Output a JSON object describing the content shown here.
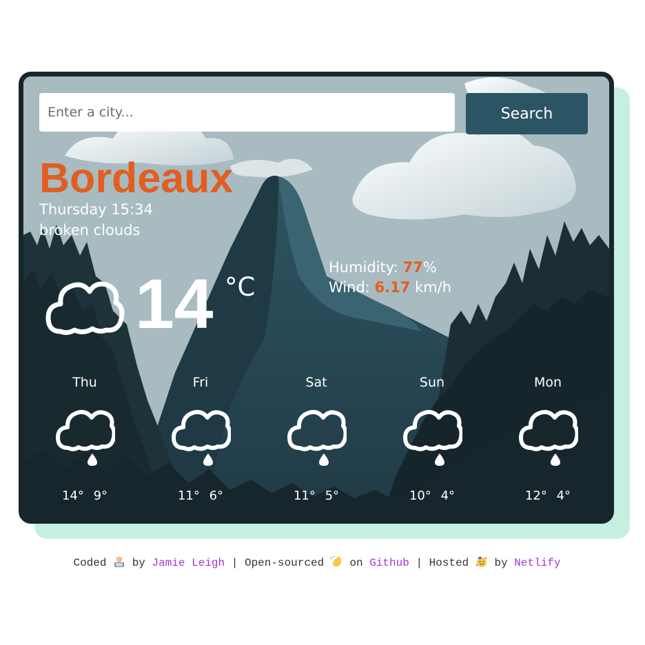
{
  "search": {
    "placeholder": "Enter a city...",
    "button_label": "Search"
  },
  "current": {
    "city": "Bordeaux",
    "datetime": "Thursday 15:34",
    "description": "broken clouds",
    "icon": "cloud-icon",
    "temperature": "14",
    "unit": "°C",
    "humidity_label": "Humidity:",
    "humidity_value": "77",
    "humidity_unit": "%",
    "wind_label": "Wind:",
    "wind_value": "6.17",
    "wind_unit": "km/h"
  },
  "forecast": [
    {
      "day": "Thu",
      "max": "14°",
      "min": "9°",
      "icon": "rain-icon"
    },
    {
      "day": "Fri",
      "max": "11°",
      "min": "6°",
      "icon": "rain-icon"
    },
    {
      "day": "Sat",
      "max": "11°",
      "min": "5°",
      "icon": "rain-icon"
    },
    {
      "day": "Sun",
      "max": "10°",
      "min": "4°",
      "icon": "rain-icon"
    },
    {
      "day": "Mon",
      "max": "12°",
      "min": "4°",
      "icon": "rain-icon"
    }
  ],
  "footer": {
    "coded": "Coded",
    "by1": "by",
    "author": "Jamie Leigh",
    "sep1": "|",
    "open_sourced": "Open-sourced",
    "on": "on",
    "github": "Github",
    "sep2": "|",
    "hosted": "Hosted",
    "by2": "by",
    "host": "Netlify",
    "icons": [
      "technologist-icon",
      "waving-hand-icon",
      "partying-face-icon"
    ]
  },
  "colors": {
    "accent": "#e25e20",
    "button": "#2b5564",
    "frame": "#17262d",
    "shadow": "#c6efe0",
    "link": "#a533d6"
  }
}
